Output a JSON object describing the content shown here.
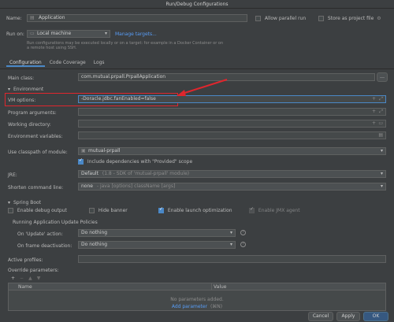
{
  "window": {
    "title": "Run/Debug Configurations"
  },
  "name_row": {
    "label": "Name:",
    "value": "Application",
    "allow_parallel_label": "Allow parallel run",
    "store_label": "Store as project file"
  },
  "run_on": {
    "label": "Run on:",
    "value": "Local machine",
    "manage_link": "Manage targets...",
    "hint": "Run configurations may be executed locally or on a target: for example in a Docker Container or on a remote host using SSH."
  },
  "tabs": [
    {
      "label": "Configuration"
    },
    {
      "label": "Code Coverage"
    },
    {
      "label": "Logs"
    }
  ],
  "main_class": {
    "label": "Main class:",
    "value": "com.mutual.prpall.PrpallApplication"
  },
  "environment": {
    "section": "Environment",
    "vm_label": "VM options:",
    "vm_value": "-Doracle.jdbc.fanEnabled=false",
    "program_args_label": "Program arguments:",
    "working_dir_label": "Working directory:",
    "env_vars_label": "Environment variables:"
  },
  "classpath": {
    "label": "Use classpath of module:",
    "value": "mutual-prpall",
    "include_label": "Include dependencies with \"Provided\" scope"
  },
  "jre": {
    "label": "JRE:",
    "value": "Default",
    "detail": "(1.8 - SDK of 'mutual-prpall' module)"
  },
  "shorten": {
    "label": "Shorten command line:",
    "value": "none",
    "detail": "- java [options] className [args]"
  },
  "spring_boot": {
    "section": "Spring Boot",
    "debug_output": "Enable debug output",
    "hide_banner": "Hide banner",
    "launch_opt": "Enable launch optimization",
    "jmx": "Enable JMX agent",
    "policies_title": "Running Application Update Policies",
    "update_label": "On 'Update' action:",
    "update_value": "Do nothing",
    "frame_label": "On frame deactivation:",
    "frame_value": "Do nothing"
  },
  "active_profiles": {
    "label": "Active profiles:"
  },
  "override": {
    "label": "Override parameters:",
    "toolbar": [
      "+",
      "−",
      "▲",
      "▼"
    ],
    "col_name": "Name",
    "col_value": "Value",
    "empty_text": "No parameters added.",
    "add_link": "Add parameter",
    "add_shortcut": "(⌘N)"
  },
  "footer": {
    "cancel": "Cancel",
    "apply": "Apply",
    "ok": "OK"
  }
}
